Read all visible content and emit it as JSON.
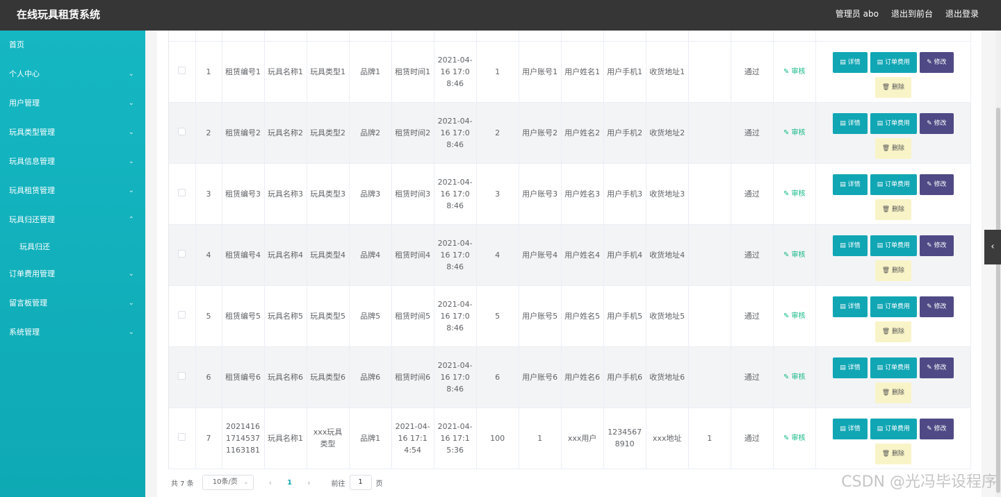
{
  "header": {
    "title": "在线玩具租赁系统",
    "admin_label": "管理员 abo",
    "to_front": "退出到前台",
    "logout": "退出登录"
  },
  "sidebar": {
    "items": [
      {
        "label": "首页",
        "icon": "none"
      },
      {
        "label": "个人中心",
        "icon": "chevron-down-icon"
      },
      {
        "label": "用户管理",
        "icon": "chevron-down-icon"
      },
      {
        "label": "玩具类型管理",
        "icon": "chevron-down-icon"
      },
      {
        "label": "玩具信息管理",
        "icon": "chevron-down-icon"
      },
      {
        "label": "玩具租赁管理",
        "icon": "chevron-down-icon"
      },
      {
        "label": "玩具归还管理",
        "icon": "chevron-up-icon"
      },
      {
        "label": "订单费用管理",
        "icon": "chevron-down-icon"
      },
      {
        "label": "留言板管理",
        "icon": "chevron-down-icon"
      },
      {
        "label": "系统管理",
        "icon": "chevron-down-icon"
      }
    ],
    "subitem": "玩具归还"
  },
  "table": {
    "audit_label": "审核",
    "buttons": {
      "detail": "详情",
      "fee": "订单费用",
      "edit": "修改",
      "delete": "删除"
    },
    "rows": [
      {
        "idx": "1",
        "c1": "租赁编号1",
        "c2": "玩具名称1",
        "c3": "玩具类型1",
        "c4": "品牌1",
        "c5": "租赁时间1",
        "c6": "2021-04-16 17:08:46",
        "c7": "1",
        "c8": "用户账号1",
        "c9": "用户姓名1",
        "c10": "用户手机1",
        "c11": "收货地址1",
        "c12": "",
        "c13": "通过"
      },
      {
        "idx": "2",
        "c1": "租赁编号2",
        "c2": "玩具名称2",
        "c3": "玩具类型2",
        "c4": "品牌2",
        "c5": "租赁时间2",
        "c6": "2021-04-16 17:08:46",
        "c7": "2",
        "c8": "用户账号2",
        "c9": "用户姓名2",
        "c10": "用户手机2",
        "c11": "收货地址2",
        "c12": "",
        "c13": "通过"
      },
      {
        "idx": "3",
        "c1": "租赁编号3",
        "c2": "玩具名称3",
        "c3": "玩具类型3",
        "c4": "品牌3",
        "c5": "租赁时间3",
        "c6": "2021-04-16 17:08:46",
        "c7": "3",
        "c8": "用户账号3",
        "c9": "用户姓名3",
        "c10": "用户手机3",
        "c11": "收货地址3",
        "c12": "",
        "c13": "通过"
      },
      {
        "idx": "4",
        "c1": "租赁编号4",
        "c2": "玩具名称4",
        "c3": "玩具类型4",
        "c4": "品牌4",
        "c5": "租赁时间4",
        "c6": "2021-04-16 17:08:46",
        "c7": "4",
        "c8": "用户账号4",
        "c9": "用户姓名4",
        "c10": "用户手机4",
        "c11": "收货地址4",
        "c12": "",
        "c13": "通过"
      },
      {
        "idx": "5",
        "c1": "租赁编号5",
        "c2": "玩具名称5",
        "c3": "玩具类型5",
        "c4": "品牌5",
        "c5": "租赁时间5",
        "c6": "2021-04-16 17:08:46",
        "c7": "5",
        "c8": "用户账号5",
        "c9": "用户姓名5",
        "c10": "用户手机5",
        "c11": "收货地址5",
        "c12": "",
        "c13": "通过"
      },
      {
        "idx": "6",
        "c1": "租赁编号6",
        "c2": "玩具名称6",
        "c3": "玩具类型6",
        "c4": "品牌6",
        "c5": "租赁时间6",
        "c6": "2021-04-16 17:08:46",
        "c7": "6",
        "c8": "用户账号6",
        "c9": "用户姓名6",
        "c10": "用户手机6",
        "c11": "收货地址6",
        "c12": "",
        "c13": "通过"
      },
      {
        "idx": "7",
        "c1": "202141617145371163181",
        "c2": "玩具名称1",
        "c3": "xxx玩具类型",
        "c4": "品牌1",
        "c5": "2021-04-16 17:14:54",
        "c6": "2021-04-16 17:15:36",
        "c7": "100",
        "c8": "1",
        "c9": "xxx用户",
        "c10": "12345678910",
        "c11": "xxx地址",
        "c12": "1",
        "c13": "通过"
      }
    ]
  },
  "pagination": {
    "total": "共 7 条",
    "page_size": "10条/页",
    "current": "1",
    "goto_label": "前往",
    "goto_value": "1",
    "page_unit": "页"
  },
  "watermark": "CSDN @光冯毕设程序"
}
